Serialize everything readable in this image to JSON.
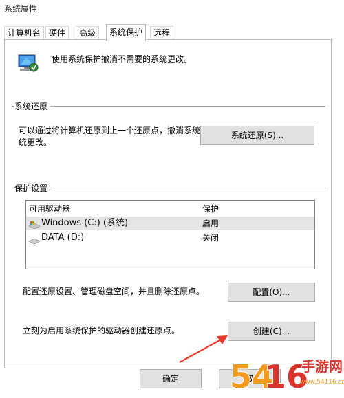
{
  "window": {
    "title": "系统属性"
  },
  "tabs": [
    {
      "label": "计算机名"
    },
    {
      "label": "硬件"
    },
    {
      "label": "高级"
    },
    {
      "label": "系统保护"
    },
    {
      "label": "远程"
    }
  ],
  "header": {
    "text": "使用系统保护撤消不需要的系统更改。"
  },
  "restore": {
    "label": "系统还原",
    "description_line1": "可以通过将计算机还原到上一个还原点，撤消系统",
    "description_line2": "统更改。",
    "button": "系统还原(S)..."
  },
  "protection": {
    "label": "保护设置",
    "columns": [
      "可用驱动器",
      "保护"
    ],
    "drives": [
      {
        "name": "Windows (C:) (系统)",
        "status": "启用"
      },
      {
        "name": "DATA (D:)",
        "status": "关闭"
      }
    ],
    "configure_text": "配置还原设置、管理磁盘空间，并且删除还原点。",
    "configure_button": "配置(O)...",
    "create_text": "立刻为启用系统保护的驱动器创建还原点。",
    "create_button": "创建(C)..."
  },
  "footer": {
    "ok": "确定",
    "cancel": "取"
  },
  "watermark": {
    "text": "手游网",
    "sub": "www.54116.com",
    "digits": "54",
    "digits2": "16"
  },
  "colors": {
    "accent_arrow": "#e8392b",
    "watermark_orange": "#f29a1e",
    "watermark_red": "#d9342b"
  }
}
